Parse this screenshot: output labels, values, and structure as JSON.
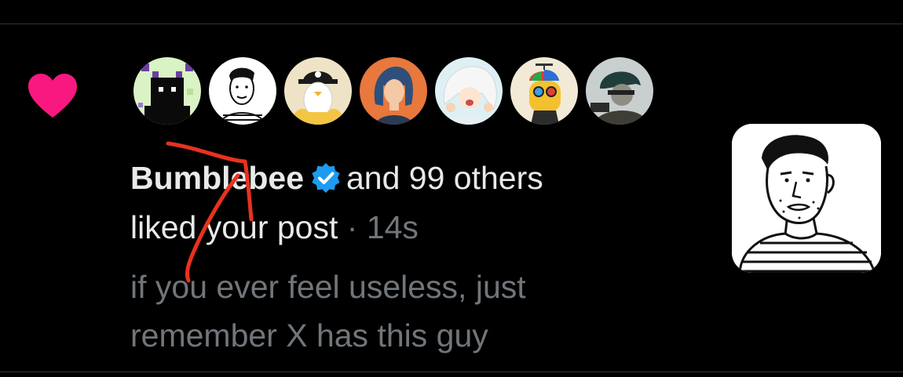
{
  "notification": {
    "icon": "heart-icon",
    "icon_color": "#f91880",
    "liker_avatars": [
      "pixel-devil-avatar",
      "sketch-man-avatar",
      "penguin-cap-avatar",
      "anime-girl-avatar",
      "white-hair-avatar",
      "propeller-hat-duck-avatar",
      "dark-hair-avatar"
    ],
    "user_name": "Bumblebee",
    "verified_icon": "verified-badge-icon",
    "verified_color": "#1d9bf0",
    "others_text": "and 99 others",
    "action_text": "liked your post",
    "separator": "·",
    "timestamp": "14s",
    "post_preview_line1": "if you ever feel useless, just",
    "post_preview_line2": "remember X has this guy",
    "thumbnail": "sketch-man-thumbnail"
  }
}
